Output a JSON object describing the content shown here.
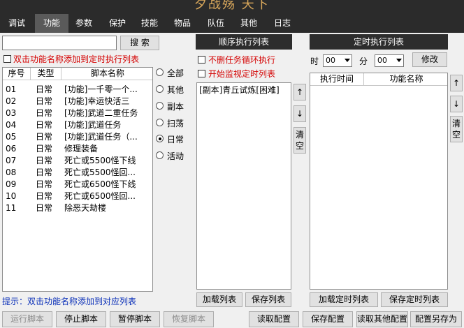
{
  "window": {
    "title": "夕战殇 天下"
  },
  "tabs": [
    {
      "label": "调试"
    },
    {
      "label": "功能"
    },
    {
      "label": "参数"
    },
    {
      "label": "保护"
    },
    {
      "label": "技能"
    },
    {
      "label": "物品"
    },
    {
      "label": "队伍"
    },
    {
      "label": "其他"
    },
    {
      "label": "日志"
    }
  ],
  "active_tab": "功能",
  "search": {
    "value": "",
    "button": "搜 索"
  },
  "left": {
    "add_hint": "双击功能名称添加到定时执行列表",
    "columns": [
      "序号",
      "类型",
      "脚本名称"
    ],
    "rows": [
      {
        "no": "01",
        "type": "日常",
        "name": "[功能]一千零一个..."
      },
      {
        "no": "02",
        "type": "日常",
        "name": "[功能]幸运快活三"
      },
      {
        "no": "03",
        "type": "日常",
        "name": "[功能]武道二重任务"
      },
      {
        "no": "04",
        "type": "日常",
        "name": "[功能]武道任务"
      },
      {
        "no": "05",
        "type": "日常",
        "name": "[功能]武道任务（..."
      },
      {
        "no": "06",
        "type": "日常",
        "name": "修理装备"
      },
      {
        "no": "07",
        "type": "日常",
        "name": "死亡或5500怪下线"
      },
      {
        "no": "08",
        "type": "日常",
        "name": "死亡或5500怪回..."
      },
      {
        "no": "09",
        "type": "日常",
        "name": "死亡或6500怪下线"
      },
      {
        "no": "10",
        "type": "日常",
        "name": "死亡或6500怪回..."
      },
      {
        "no": "11",
        "type": "日常",
        "name": "除恶天劫楼"
      }
    ],
    "filters": [
      {
        "label": "全部",
        "selected": false
      },
      {
        "label": "其他",
        "selected": false
      },
      {
        "label": "副本",
        "selected": false
      },
      {
        "label": "扫荡",
        "selected": false
      },
      {
        "label": "日常",
        "selected": true
      },
      {
        "label": "活动",
        "selected": false
      }
    ],
    "bottom_hint": "提示：双击功能名称添加到对应列表"
  },
  "middle": {
    "header": "顺序执行列表",
    "opt_no_delete": "不删任务循环执行",
    "opt_monitor": "开始监视定时列表",
    "items": [
      "[副本]青丘试炼[困难]"
    ],
    "up": "↑",
    "down": "↓",
    "clear": "清空",
    "load_button": "加载列表",
    "save_button": "保存列表"
  },
  "right": {
    "header": "定时执行列表",
    "hour_label": "时",
    "hour_value": "00",
    "minute_label": "分",
    "minute_value": "00",
    "modify_button": "修改",
    "columns": [
      "执行时间",
      "功能名称"
    ],
    "up": "↑",
    "down": "↓",
    "clear": "清空",
    "load_button": "加载定时列表",
    "save_button": "保存定时列表"
  },
  "bottom_bar": {
    "run": "运行脚本",
    "stop": "停止脚本",
    "pause": "暂停脚本",
    "resume": "恢复脚本",
    "read_config": "读取配置",
    "save_config": "保存配置",
    "read_other": "读取其他配置",
    "save_as": "配置另存为"
  },
  "colors": {
    "dark_bar": "#2b2b2b",
    "active_tab": "#5a5a5a",
    "title_gold": "#d8a75b",
    "warning_red": "#d40000",
    "hint_blue": "#0a2fb8"
  }
}
